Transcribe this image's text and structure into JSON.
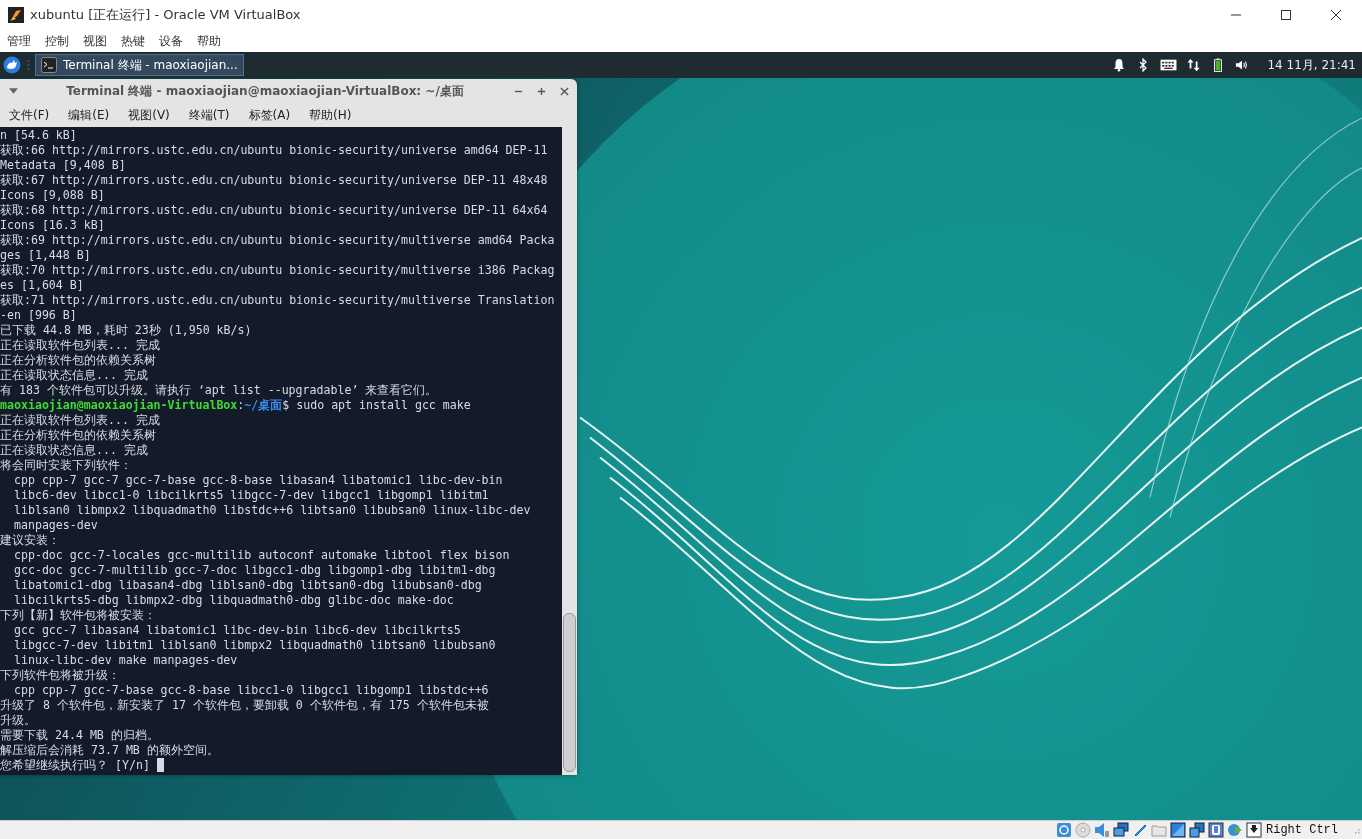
{
  "window": {
    "title": "xubuntu [正在运行] - Oracle VM VirtualBox"
  },
  "menu": [
    "管理",
    "控制",
    "视图",
    "热键",
    "设备",
    "帮助"
  ],
  "panel": {
    "tasks": [
      {
        "label": "Terminal 终端 - maoxiaojian...",
        "selected": true
      }
    ],
    "clock": "14 11月, 21:41"
  },
  "terminal": {
    "title": "Terminal 终端 - maoxiaojian@maoxiaojian-VirtualBox: ~/桌面",
    "menu": [
      "文件(F)",
      "编辑(E)",
      "视图(V)",
      "终端(T)",
      "标签(A)",
      "帮助(H)"
    ],
    "lines": [
      {
        "kind": "output",
        "text": "n [54.6 kB]"
      },
      {
        "kind": "output",
        "text": "获取:66 http://mirrors.ustc.edu.cn/ubuntu bionic-security/universe amd64 DEP-11"
      },
      {
        "kind": "output",
        "text": "Metadata [9,408 B]"
      },
      {
        "kind": "output",
        "text": "获取:67 http://mirrors.ustc.edu.cn/ubuntu bionic-security/universe DEP-11 48x48"
      },
      {
        "kind": "output",
        "text": "Icons [9,088 B]"
      },
      {
        "kind": "output",
        "text": "获取:68 http://mirrors.ustc.edu.cn/ubuntu bionic-security/universe DEP-11 64x64"
      },
      {
        "kind": "output",
        "text": "Icons [16.3 kB]"
      },
      {
        "kind": "output",
        "text": "获取:69 http://mirrors.ustc.edu.cn/ubuntu bionic-security/multiverse amd64 Packa"
      },
      {
        "kind": "output",
        "text": "ges [1,448 B]"
      },
      {
        "kind": "output",
        "text": "获取:70 http://mirrors.ustc.edu.cn/ubuntu bionic-security/multiverse i386 Packag"
      },
      {
        "kind": "output",
        "text": "es [1,604 B]"
      },
      {
        "kind": "output",
        "text": "获取:71 http://mirrors.ustc.edu.cn/ubuntu bionic-security/multiverse Translation"
      },
      {
        "kind": "output",
        "text": "-en [996 B]"
      },
      {
        "kind": "output",
        "text": "已下载 44.8 MB，耗时 23秒 (1,950 kB/s)"
      },
      {
        "kind": "output",
        "text": "正在读取软件包列表... 完成"
      },
      {
        "kind": "output",
        "text": "正在分析软件包的依赖关系树"
      },
      {
        "kind": "output",
        "text": "正在读取状态信息... 完成"
      },
      {
        "kind": "output",
        "text": "有 183 个软件包可以升级。请执行 ‘apt list --upgradable’ 来查看它们。"
      },
      {
        "kind": "prompt",
        "user": "maoxiaojian@maoxiaojian-VirtualBox",
        "sep": ":",
        "path": "~/桌面",
        "text": "$ sudo apt install gcc make"
      },
      {
        "kind": "output",
        "text": "正在读取软件包列表... 完成"
      },
      {
        "kind": "output",
        "text": "正在分析软件包的依赖关系树"
      },
      {
        "kind": "output",
        "text": "正在读取状态信息... 完成"
      },
      {
        "kind": "output",
        "text": "将会同时安装下列软件："
      },
      {
        "kind": "output",
        "text": "  cpp cpp-7 gcc-7 gcc-7-base gcc-8-base libasan4 libatomic1 libc-dev-bin"
      },
      {
        "kind": "output",
        "text": "  libc6-dev libcc1-0 libcilkrts5 libgcc-7-dev libgcc1 libgomp1 libitm1"
      },
      {
        "kind": "output",
        "text": "  liblsan0 libmpx2 libquadmath0 libstdc++6 libtsan0 libubsan0 linux-libc-dev"
      },
      {
        "kind": "output",
        "text": "  manpages-dev"
      },
      {
        "kind": "output",
        "text": "建议安装："
      },
      {
        "kind": "output",
        "text": "  cpp-doc gcc-7-locales gcc-multilib autoconf automake libtool flex bison"
      },
      {
        "kind": "output",
        "text": "  gcc-doc gcc-7-multilib gcc-7-doc libgcc1-dbg libgomp1-dbg libitm1-dbg"
      },
      {
        "kind": "output",
        "text": "  libatomic1-dbg libasan4-dbg liblsan0-dbg libtsan0-dbg libubsan0-dbg"
      },
      {
        "kind": "output",
        "text": "  libcilkrts5-dbg libmpx2-dbg libquadmath0-dbg glibc-doc make-doc"
      },
      {
        "kind": "output",
        "text": "下列【新】软件包将被安装："
      },
      {
        "kind": "output",
        "text": "  gcc gcc-7 libasan4 libatomic1 libc-dev-bin libc6-dev libcilkrts5"
      },
      {
        "kind": "output",
        "text": "  libgcc-7-dev libitm1 liblsan0 libmpx2 libquadmath0 libtsan0 libubsan0"
      },
      {
        "kind": "output",
        "text": "  linux-libc-dev make manpages-dev"
      },
      {
        "kind": "output",
        "text": "下列软件包将被升级："
      },
      {
        "kind": "output",
        "text": "  cpp cpp-7 gcc-7-base gcc-8-base libcc1-0 libgcc1 libgomp1 libstdc++6"
      },
      {
        "kind": "output",
        "text": "升级了 8 个软件包，新安装了 17 个软件包，要卸载 0 个软件包，有 175 个软件包未被"
      },
      {
        "kind": "output",
        "text": "升级。"
      },
      {
        "kind": "output",
        "text": "需要下载 24.4 MB 的归档。"
      },
      {
        "kind": "output",
        "text": "解压缩后会消耗 73.7 MB 的额外空间。"
      },
      {
        "kind": "input",
        "text": "您希望继续执行吗？ [Y/n] "
      }
    ]
  },
  "status_bar": {
    "host_key": "Right Ctrl"
  }
}
